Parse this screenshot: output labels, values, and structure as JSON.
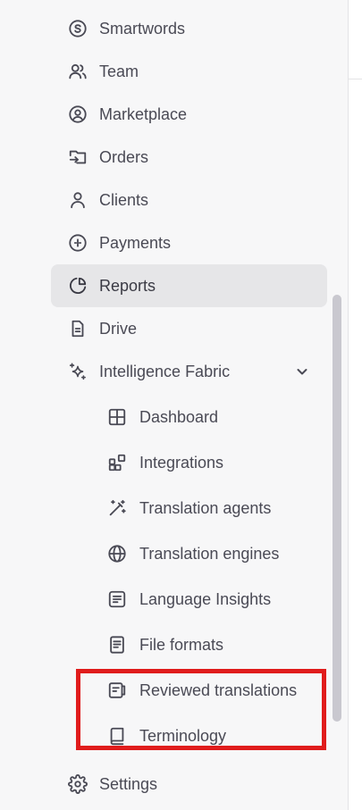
{
  "nav": {
    "items": [
      {
        "label": "Smartwords",
        "icon": "smartwords-icon"
      },
      {
        "label": "Team",
        "icon": "team-icon"
      },
      {
        "label": "Marketplace",
        "icon": "marketplace-icon"
      },
      {
        "label": "Orders",
        "icon": "orders-icon"
      },
      {
        "label": "Clients",
        "icon": "clients-icon"
      },
      {
        "label": "Payments",
        "icon": "payments-icon"
      },
      {
        "label": "Reports",
        "icon": "reports-icon",
        "active": true
      },
      {
        "label": "Drive",
        "icon": "drive-icon"
      },
      {
        "label": "Intelligence Fabric",
        "icon": "sparkle-icon",
        "expanded": true
      }
    ],
    "sub_items": [
      {
        "label": "Dashboard",
        "icon": "dashboard-grid-icon"
      },
      {
        "label": "Integrations",
        "icon": "integrations-icon"
      },
      {
        "label": "Translation agents",
        "icon": "magic-wand-icon"
      },
      {
        "label": "Translation engines",
        "icon": "globe-icon"
      },
      {
        "label": "Language Insights",
        "icon": "insights-doc-icon"
      },
      {
        "label": "File formats",
        "icon": "file-icon"
      },
      {
        "label": "Reviewed translations",
        "icon": "reviewed-doc-icon"
      },
      {
        "label": "Terminology",
        "icon": "book-icon"
      }
    ],
    "footer": {
      "label": "Settings",
      "icon": "gear-icon"
    }
  },
  "colors": {
    "sidebar_bg": "#f7f7f8",
    "active_bg": "#e6e6e8",
    "text": "#4a4a55",
    "icon": "#4a4a55",
    "highlight": "#e01c1c",
    "scrollbar": "#c9c8cf"
  }
}
